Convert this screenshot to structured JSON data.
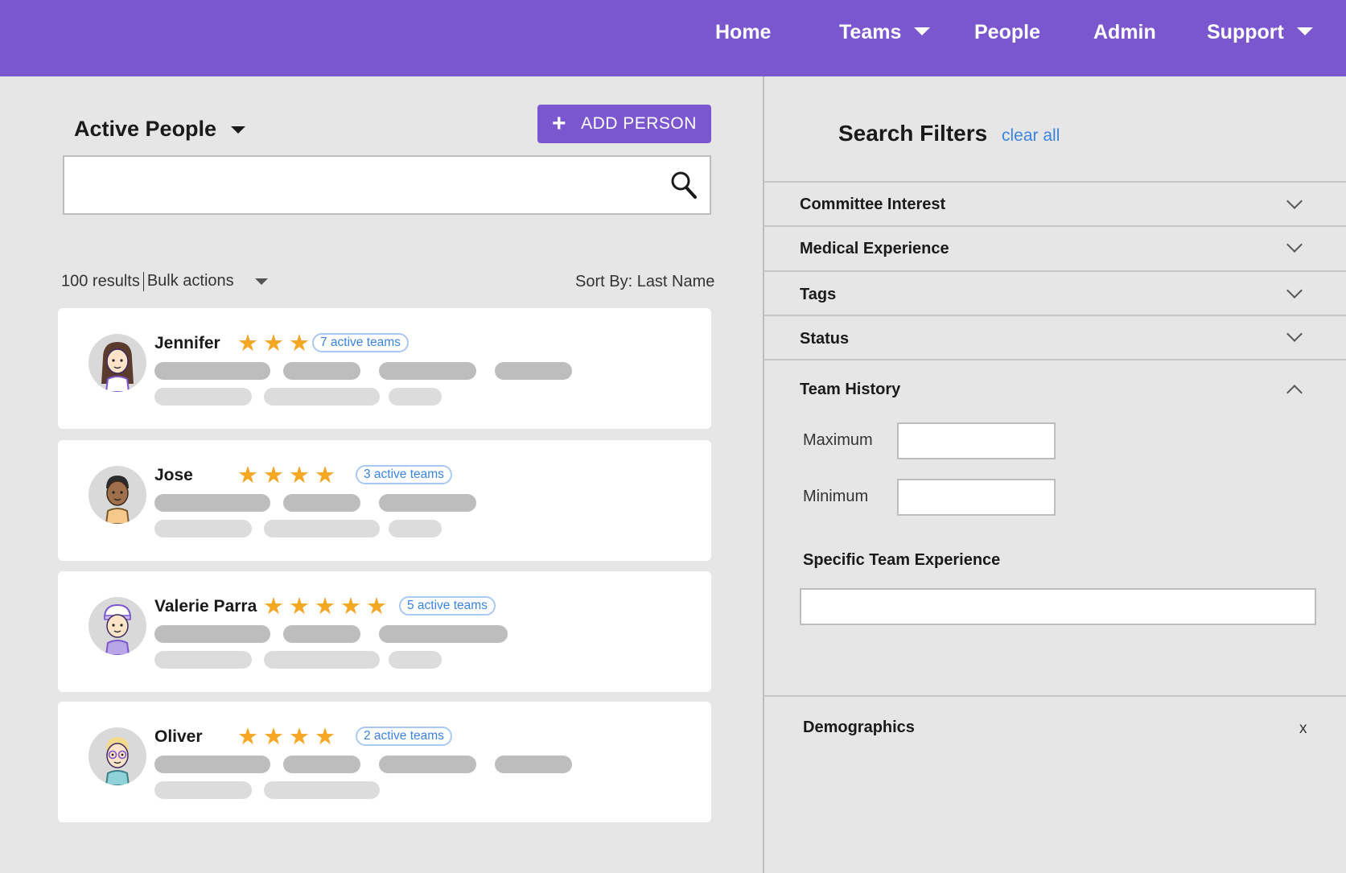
{
  "nav": {
    "items": [
      {
        "label": "Home",
        "has_dropdown": false
      },
      {
        "label": "Teams",
        "has_dropdown": true
      },
      {
        "label": "People",
        "has_dropdown": false
      },
      {
        "label": "Admin",
        "has_dropdown": false
      },
      {
        "label": "Support",
        "has_dropdown": true
      }
    ],
    "bg_color": "#7b57cf"
  },
  "left": {
    "title": "Active People",
    "add_button": "ADD PERSON",
    "search_placeholder": "",
    "results_count": "100 results",
    "bulk_actions": "Bulk actions",
    "sort_label": "Sort By: Last Name"
  },
  "people": [
    {
      "name": "Jennifer",
      "stars": "★★★",
      "rating": 3,
      "teams": "7 active teams"
    },
    {
      "name": "Jose",
      "stars": "★★★★",
      "rating": 4,
      "teams": "3 active teams"
    },
    {
      "name": "Valerie Parra",
      "stars": "★★★★★",
      "rating": 5,
      "teams": "5 active teams"
    },
    {
      "name": "Oliver",
      "stars": "★★★★",
      "rating": 4,
      "teams": "2 active teams"
    }
  ],
  "filters": {
    "title": "Search Filters",
    "clear_all": "clear all",
    "sections": [
      {
        "label": "Committee Interest",
        "expanded": false
      },
      {
        "label": "Medical Experience",
        "expanded": false
      },
      {
        "label": "Tags",
        "expanded": false
      },
      {
        "label": "Status",
        "expanded": false
      },
      {
        "label": "Team History",
        "expanded": true
      }
    ],
    "maximum_label": "Maximum",
    "minimum_label": "Minimum",
    "specific_team_label": "Specific Team Experience",
    "demographics_label": "Demographics",
    "close_label": "x"
  },
  "colors": {
    "accent": "#7b57cf",
    "star": "#f5a623",
    "link": "#3a84e0"
  }
}
